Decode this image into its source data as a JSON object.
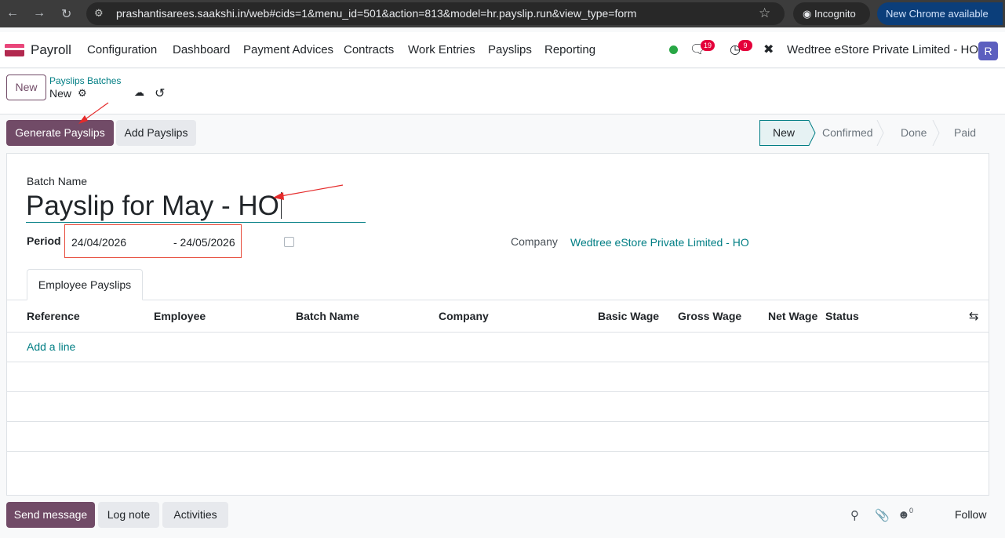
{
  "browser": {
    "url": "prashantisarees.saakshi.in/web#cids=1&menu_id=501&action=813&model=hr.payslip.run&view_type=form",
    "incognito_label": "Incognito",
    "update_label": "New Chrome available"
  },
  "navbar": {
    "app_name": "Payroll",
    "menu": [
      "Configuration",
      "Dashboard",
      "Payment Advices",
      "Contracts",
      "Work Entries",
      "Payslips",
      "Reporting"
    ],
    "messages_count": "19",
    "activities_count": "9",
    "company": "Wedtree eStore Private Limited - HO",
    "avatar_letter": "R"
  },
  "control_panel": {
    "new_label": "New",
    "breadcrumb_parent": "Payslips Batches",
    "breadcrumb_current": "New"
  },
  "statusbar": {
    "generate_label": "Generate Payslips",
    "add_label": "Add Payslips",
    "stages": [
      "New",
      "Confirmed",
      "Done",
      "Paid"
    ],
    "active_stage": "New"
  },
  "form": {
    "batch_name_label": "Batch Name",
    "batch_name_value": "Payslip for May - HO",
    "period_label": "Period",
    "date_start": "24/04/2026",
    "date_end": "- 24/05/2026",
    "company_label": "Company",
    "company_value": "Wedtree eStore Private Limited - HO"
  },
  "tabs": {
    "employee_payslips": "Employee Payslips"
  },
  "table": {
    "headers": [
      "Reference",
      "Employee",
      "Batch Name",
      "Company",
      "Basic Wage",
      "Gross Wage",
      "Net Wage",
      "Status"
    ],
    "add_line": "Add a line"
  },
  "chatter": {
    "send_message": "Send message",
    "log_note": "Log note",
    "activities": "Activities",
    "followers_count": "0",
    "follow": "Follow"
  },
  "colors": {
    "brand": "#714b67",
    "link": "#017e84",
    "annotation": "#e52b2b"
  }
}
